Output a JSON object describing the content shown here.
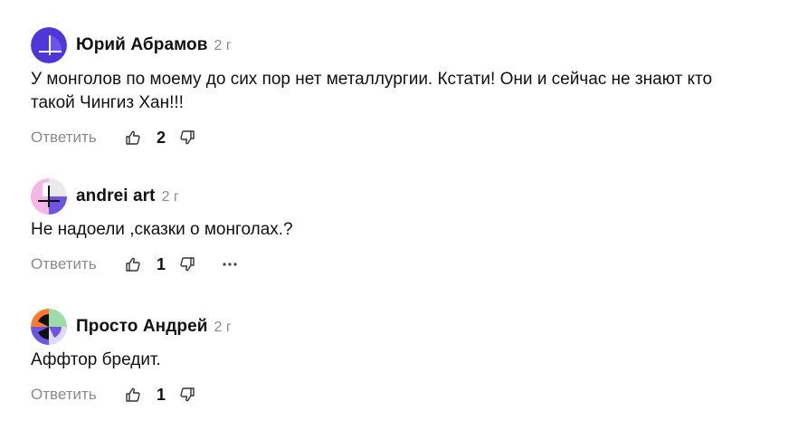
{
  "comments": [
    {
      "author": "Юрий Абрамов",
      "time": "2 г",
      "text_lines": [
        "У монголов по моему до сих пор нет металлургии. Кстати! Они и сейчас не знают кто",
        "такой Чингиз Хан!!!"
      ],
      "reply_label": "Ответить",
      "likes": "2",
      "avatar_colors": [
        "#4e36d8",
        "#ffffff"
      ]
    },
    {
      "author": "andrei art",
      "time": "2 г",
      "text_lines": [
        "Не надоели ,сказки о монголах.?"
      ],
      "reply_label": "Ответить",
      "likes": "1",
      "more_icon": "ellipsis-icon",
      "avatar_colors": [
        "#f6b6e6",
        "#e9e9ee",
        "#6c55e0",
        "#111111"
      ]
    },
    {
      "author": "Просто Андрей",
      "time": "2 г",
      "text_lines": [
        "Аффтор бредит."
      ],
      "reply_label": "Ответить",
      "likes": "1",
      "avatar_colors": [
        "#ff7a2f",
        "#9fdba9",
        "#6c55e0",
        "#e2d9ff"
      ]
    }
  ],
  "icons": {
    "like": "thumbs-up-icon",
    "dislike": "thumbs-down-icon"
  }
}
